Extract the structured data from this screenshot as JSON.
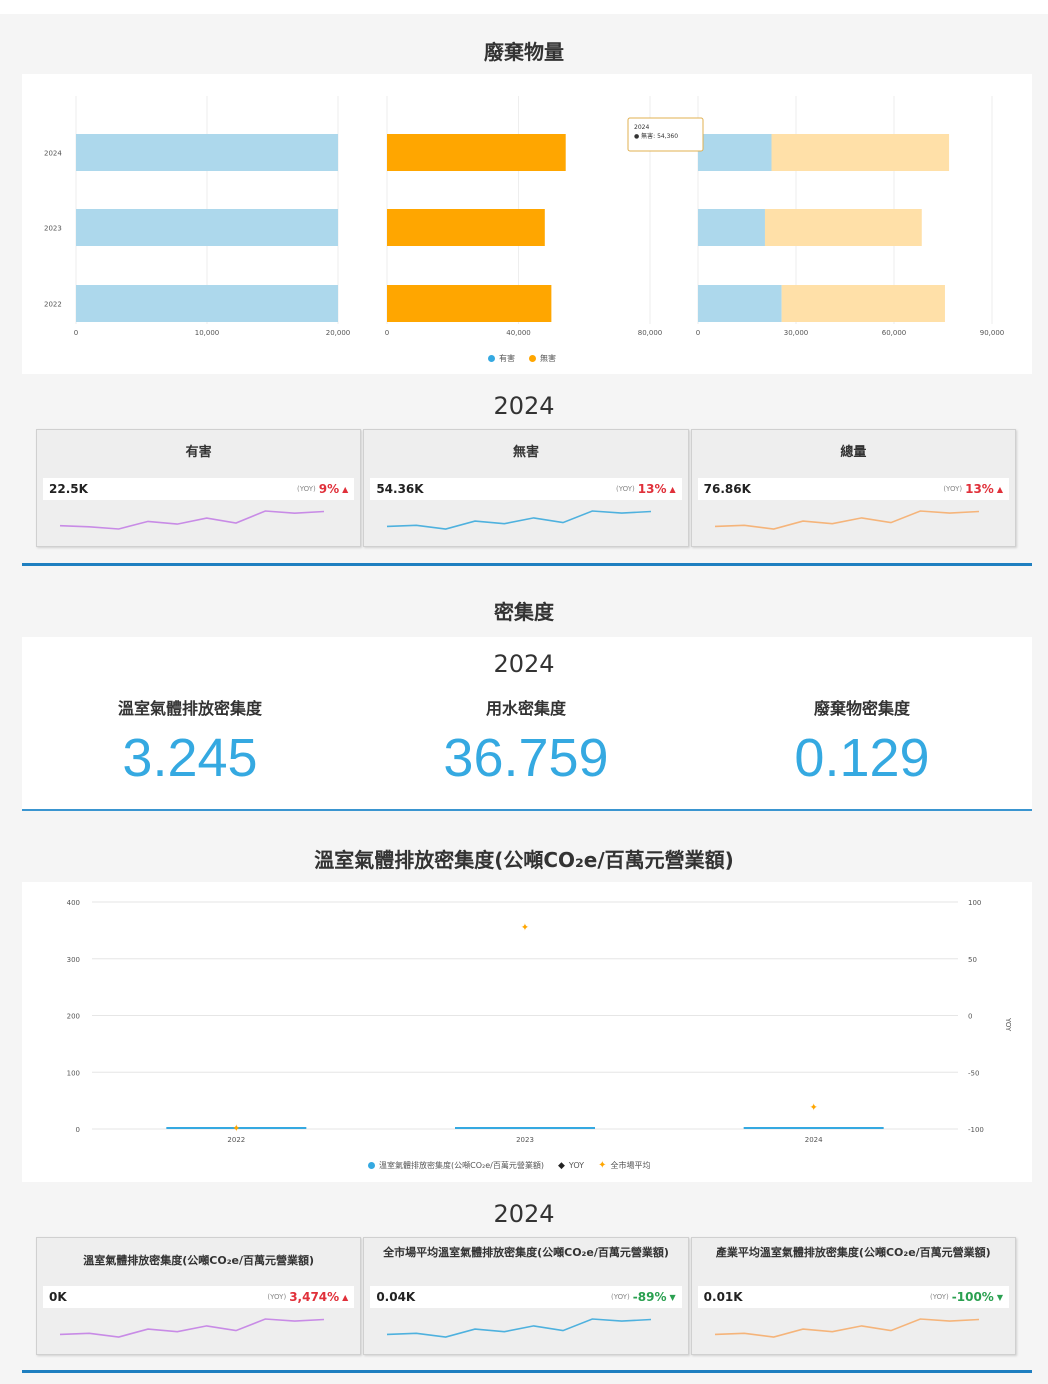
{
  "section1": {
    "title": "廢棄物量",
    "chart_data": {
      "type": "bar",
      "orientation": "horizontal",
      "categories": [
        "2024",
        "2023",
        "2022"
      ],
      "panels": [
        {
          "series": [
            {
              "name": "有害",
              "values": [
                22500,
                20500,
                25600
              ]
            }
          ],
          "ticks": [
            "0",
            "10,000",
            "20,000"
          ],
          "xlim": [
            0,
            20000
          ]
        },
        {
          "series": [
            {
              "name": "無害",
              "values": [
                54360,
                48000,
                50000
              ]
            }
          ],
          "ticks": [
            "0",
            "40,000",
            "80,000"
          ],
          "xlim": [
            0,
            80000
          ]
        },
        {
          "stacked": true,
          "series": [
            {
              "name": "有害",
              "values": [
                22500,
                20500,
                25600
              ]
            },
            {
              "name": "無害",
              "values": [
                54360,
                48000,
                50000
              ]
            }
          ],
          "ticks": [
            "0",
            "30,000",
            "60,000",
            "90,000"
          ],
          "xlim": [
            0,
            90000
          ]
        }
      ],
      "legend": [
        {
          "name": "有害",
          "color": "#35a9e1"
        },
        {
          "name": "無害",
          "color": "#ffa600"
        }
      ],
      "tooltip": {
        "title": "2024",
        "label": "無害",
        "value": "54,360"
      },
      "colors": {
        "hazard": "#add8ec",
        "nonhazard": "#ffa600",
        "nonhazard_light": "#ffe0a8"
      }
    },
    "year": "2024",
    "cards": [
      {
        "title": "有害",
        "value": "22.5K",
        "yoy_tag": "(YOY)",
        "yoy": "9%",
        "dir": "up",
        "color": "#c88be6",
        "trend": [
          4.2,
          4.0,
          3.6,
          5.0,
          4.5,
          5.6,
          4.7,
          6.9,
          6.5,
          6.8
        ]
      },
      {
        "title": "無害",
        "value": "54.36K",
        "yoy_tag": "(YOY)",
        "yoy": "13%",
        "dir": "up",
        "color": "#4eb1de",
        "trend": [
          4.0,
          4.2,
          3.5,
          5.0,
          4.5,
          5.6,
          4.7,
          6.9,
          6.5,
          6.8
        ]
      },
      {
        "title": "總量",
        "value": "76.86K",
        "yoy_tag": "(YOY)",
        "yoy": "13%",
        "dir": "up",
        "color": "#f5b47a",
        "trend": [
          4.0,
          4.2,
          3.5,
          5.0,
          4.5,
          5.6,
          4.7,
          6.9,
          6.5,
          6.8
        ]
      }
    ]
  },
  "section2": {
    "title": "密集度",
    "year": "2024",
    "stats": [
      {
        "label": "溫室氣體排放密集度",
        "value": "3.245"
      },
      {
        "label": "用水密集度",
        "value": "36.759"
      },
      {
        "label": "廢棄物密集度",
        "value": "0.129"
      }
    ]
  },
  "section3": {
    "title": "溫室氣體排放密集度(公噸CO₂e/百萬元營業額)",
    "chart_data": {
      "type": "line",
      "categories": [
        "2022",
        "2023",
        "2024"
      ],
      "y_left": {
        "ticks": [
          "0",
          "100",
          "200",
          "300",
          "400"
        ],
        "ylim": [
          0,
          400
        ]
      },
      "y_right": {
        "ticks": [
          "-100",
          "-50",
          "0",
          "50",
          "100"
        ],
        "ylim": [
          -100,
          100
        ],
        "label": "YOY"
      },
      "series": [
        {
          "name": "溫室氣體排放密集度(公噸CO₂e/百萬元營業額)",
          "type": "bar",
          "color": "#35a9e1",
          "values": [
            0,
            0,
            3.245
          ]
        },
        {
          "name": "YOY",
          "type": "line",
          "color": "#222222",
          "values": [
            null,
            null,
            null
          ]
        },
        {
          "name": "全市場平均",
          "type": "scatter",
          "color": "#ffa600",
          "values": [
            0.5,
            355,
            38
          ]
        }
      ]
    },
    "year": "2024",
    "cards": [
      {
        "title": "溫室氣體排放密集度(公噸CO₂e/百萬元營業額)",
        "value": "0K",
        "yoy_tag": "(YOY)",
        "yoy": "3,474%",
        "dir": "up",
        "color": "#c88be6",
        "trend": [
          4.0,
          4.2,
          3.5,
          5.0,
          4.5,
          5.6,
          4.7,
          6.9,
          6.5,
          6.8
        ]
      },
      {
        "title": "全市場平均溫室氣體排放密集度(公噸CO₂e/百萬元營業額)",
        "value": "0.04K",
        "yoy_tag": "(YOY)",
        "yoy": "-89%",
        "dir": "down",
        "color": "#4eb1de",
        "trend": [
          4.0,
          4.2,
          3.5,
          5.0,
          4.5,
          5.6,
          4.7,
          6.9,
          6.5,
          6.8
        ]
      },
      {
        "title": "產業平均溫室氣體排放密集度(公噸CO₂e/百萬元營業額)",
        "value": "0.01K",
        "yoy_tag": "(YOY)",
        "yoy": "-100%",
        "dir": "down",
        "color": "#f5b47a",
        "trend": [
          4.0,
          4.2,
          3.5,
          5.0,
          4.5,
          5.6,
          4.7,
          6.9,
          6.5,
          6.8
        ]
      }
    ]
  }
}
